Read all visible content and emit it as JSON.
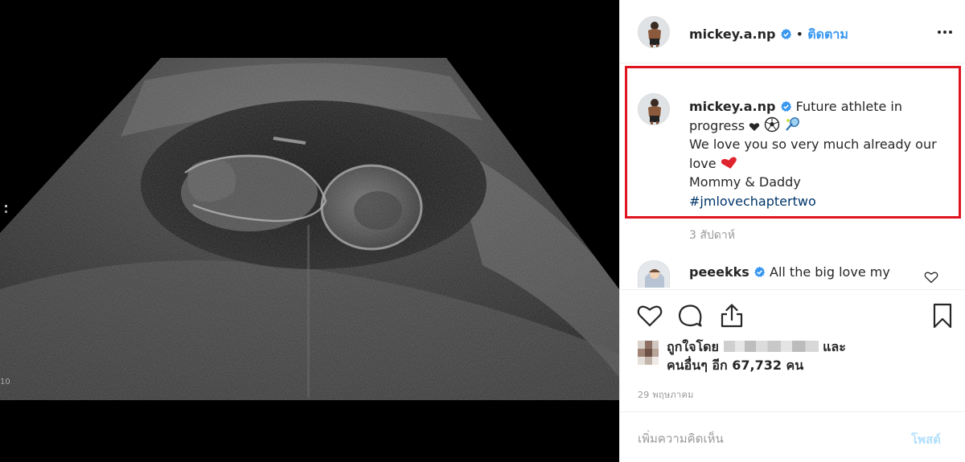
{
  "media": {
    "scale_label": "10"
  },
  "header": {
    "username": "mickey.a.np",
    "separator": "•",
    "follow_label": "ติดตาม",
    "more_label": "⋯"
  },
  "caption": {
    "username": "mickey.a.np",
    "line1": "Future athlete in",
    "line2": "progress",
    "line2_emoji": [
      "heart-icon",
      "soccer-ball-icon",
      "tennis-racket-icon"
    ],
    "line3": "We love you so very much already our",
    "line4": "love",
    "line4_emoji": [
      "red-heart-icon"
    ],
    "line5": "Mommy & Daddy",
    "hashtag": "#jmlovechaptertwo",
    "time_ago": "3 สัปดาห์"
  },
  "comment": {
    "username": "peeekks",
    "text": "All the big love my"
  },
  "actions": {
    "icons": [
      "heart-icon",
      "comment-icon",
      "share-icon",
      "bookmark-icon"
    ]
  },
  "likes": {
    "prefix": "ถูกใจโดย",
    "suffix": "และ",
    "line2": "คนอื่นๆ อีก 67,732 คน"
  },
  "post_date": "29 พฤษภาคม",
  "add_comment": {
    "placeholder": "เพิ่มความคิดเห็น",
    "post_label": "โพสต์"
  },
  "colors": {
    "follow_blue": "#3897f0",
    "verified_blue": "#3897f0",
    "highlight_red": "#e0141e",
    "post_disabled": "#b2dffc",
    "hashtag": "#003569"
  }
}
